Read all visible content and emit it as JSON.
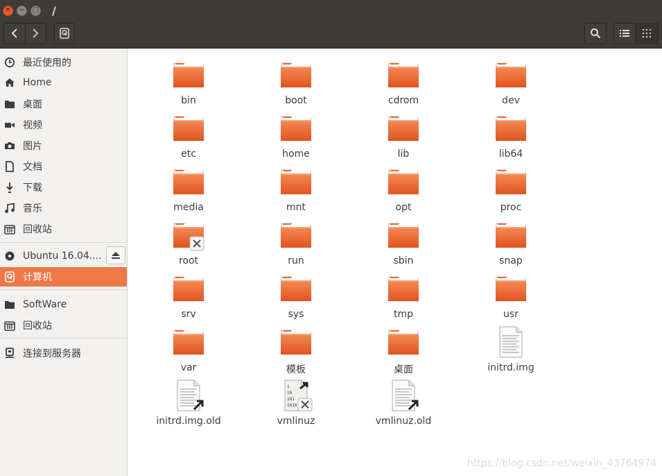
{
  "window": {
    "title": "/"
  },
  "sidebar": {
    "items": [
      {
        "label": "最近使用的",
        "icon": "recent-icon"
      },
      {
        "label": "Home",
        "icon": "home-icon"
      },
      {
        "label": "桌面",
        "icon": "folder-icon"
      },
      {
        "label": "视频",
        "icon": "video-icon"
      },
      {
        "label": "图片",
        "icon": "camera-icon"
      },
      {
        "label": "文档",
        "icon": "document-icon"
      },
      {
        "label": "下载",
        "icon": "download-icon"
      },
      {
        "label": "音乐",
        "icon": "music-icon"
      },
      {
        "label": "回收站",
        "icon": "trash-icon"
      },
      {
        "label": "Ubuntu 16.04....",
        "icon": "disc-icon"
      },
      {
        "label": "计算机",
        "icon": "computer-icon",
        "active": true
      },
      {
        "label": "SoftWare",
        "icon": "folder-icon"
      },
      {
        "label": "回收站",
        "icon": "trash-icon"
      },
      {
        "label": "连接到服务器",
        "icon": "server-icon"
      }
    ]
  },
  "files": [
    {
      "name": "bin",
      "type": "folder"
    },
    {
      "name": "boot",
      "type": "folder"
    },
    {
      "name": "cdrom",
      "type": "folder"
    },
    {
      "name": "dev",
      "type": "folder"
    },
    {
      "name": "etc",
      "type": "folder"
    },
    {
      "name": "home",
      "type": "folder"
    },
    {
      "name": "lib",
      "type": "folder"
    },
    {
      "name": "lib64",
      "type": "folder"
    },
    {
      "name": "media",
      "type": "folder"
    },
    {
      "name": "mnt",
      "type": "folder"
    },
    {
      "name": "opt",
      "type": "folder"
    },
    {
      "name": "proc",
      "type": "folder"
    },
    {
      "name": "root",
      "type": "folder-locked"
    },
    {
      "name": "run",
      "type": "folder"
    },
    {
      "name": "sbin",
      "type": "folder"
    },
    {
      "name": "snap",
      "type": "folder"
    },
    {
      "name": "srv",
      "type": "folder"
    },
    {
      "name": "sys",
      "type": "folder"
    },
    {
      "name": "tmp",
      "type": "folder"
    },
    {
      "name": "usr",
      "type": "folder"
    },
    {
      "name": "var",
      "type": "folder"
    },
    {
      "name": "模板",
      "type": "folder"
    },
    {
      "name": "桌面",
      "type": "folder"
    },
    {
      "name": "initrd.img",
      "type": "text-file"
    },
    {
      "name": "initrd.img.old",
      "type": "text-link"
    },
    {
      "name": "vmlinuz",
      "type": "binary-link-locked"
    },
    {
      "name": "vmlinuz.old",
      "type": "text-link"
    }
  ],
  "watermark": "https://blog.csdn.net/weixin_43764974",
  "colors": {
    "accent": "#f07746",
    "titlebar": "#3d3c38",
    "folder": "#e9642b",
    "close_button": "#e65a30"
  }
}
